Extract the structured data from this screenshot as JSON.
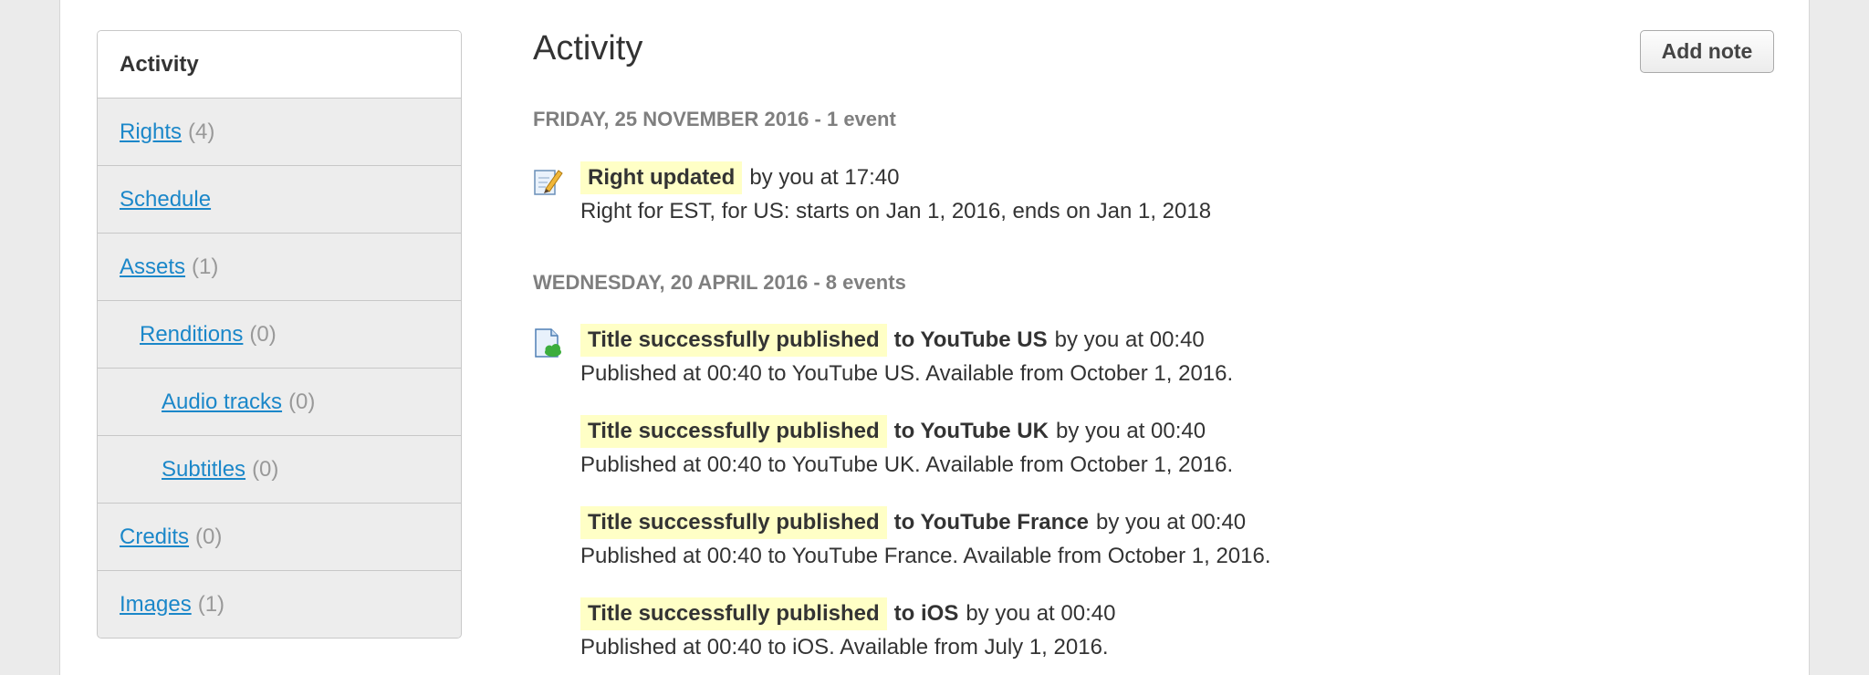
{
  "sidebar": {
    "items": [
      {
        "label": "Activity",
        "count": ""
      },
      {
        "label": "Rights",
        "count": "(4)"
      },
      {
        "label": "Schedule",
        "count": ""
      },
      {
        "label": "Assets",
        "count": "(1)"
      },
      {
        "label": "Renditions",
        "count": "(0)"
      },
      {
        "label": "Audio tracks",
        "count": "(0)"
      },
      {
        "label": "Subtitles",
        "count": "(0)"
      },
      {
        "label": "Credits",
        "count": "(0)"
      },
      {
        "label": "Images",
        "count": "(1)"
      }
    ]
  },
  "main": {
    "title": "Activity",
    "add_note_label": "Add note",
    "days": [
      {
        "header": "FRIDAY, 25 NOVEMBER 2016 - 1 event",
        "events": [
          {
            "icon": "edit-pencil-icon",
            "highlight": "Right updated",
            "target": "",
            "suffix": "by you at 17:40",
            "detail": "Right for EST, for US: starts on Jan 1, 2016, ends on Jan 1, 2018"
          }
        ]
      },
      {
        "header": "WEDNESDAY, 20 APRIL 2016 - 8 events",
        "events": [
          {
            "icon": "publish-document-icon",
            "highlight": "Title successfully published",
            "target": "to YouTube US",
            "suffix": "by you at 00:40",
            "detail": "Published at 00:40 to YouTube US. Available from October 1, 2016."
          },
          {
            "icon": "",
            "highlight": "Title successfully published",
            "target": "to YouTube UK",
            "suffix": "by you at 00:40",
            "detail": "Published at 00:40 to YouTube UK. Available from October 1, 2016."
          },
          {
            "icon": "",
            "highlight": "Title successfully published",
            "target": "to YouTube France",
            "suffix": "by you at 00:40",
            "detail": "Published at 00:40 to YouTube France. Available from October 1, 2016."
          },
          {
            "icon": "",
            "highlight": "Title successfully published",
            "target": "to iOS",
            "suffix": "by you at 00:40",
            "detail": "Published at 00:40 to iOS. Available from July 1, 2016."
          }
        ]
      }
    ]
  },
  "colors": {
    "link": "#1b87c9",
    "highlight": "#ffffc6",
    "day_header": "#7f7f7f",
    "background": "#ebebeb"
  }
}
